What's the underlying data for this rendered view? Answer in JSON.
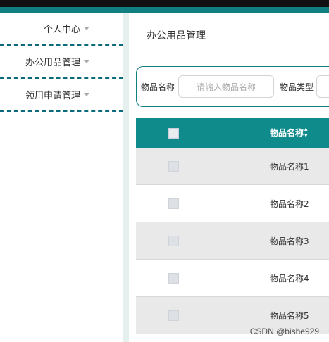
{
  "sidebar": {
    "items": [
      {
        "label": "个人中心"
      },
      {
        "label": "办公用品管理"
      },
      {
        "label": "领用申请管理"
      }
    ]
  },
  "main": {
    "title": "办公用品管理",
    "filter": {
      "name_label": "物品名称",
      "name_placeholder": "请输入物品名称",
      "type_label": "物品类型"
    },
    "table": {
      "header": {
        "name": "物品名称"
      },
      "rows": [
        {
          "name": "物品名称1"
        },
        {
          "name": "物品名称2"
        },
        {
          "name": "物品名称3"
        },
        {
          "name": "物品名称4"
        },
        {
          "name": "物品名称5"
        }
      ]
    }
  },
  "watermark": "CSDN @bishe929",
  "colors": {
    "accent": "#0f7f82",
    "header_bg": "#0f8b8c"
  }
}
